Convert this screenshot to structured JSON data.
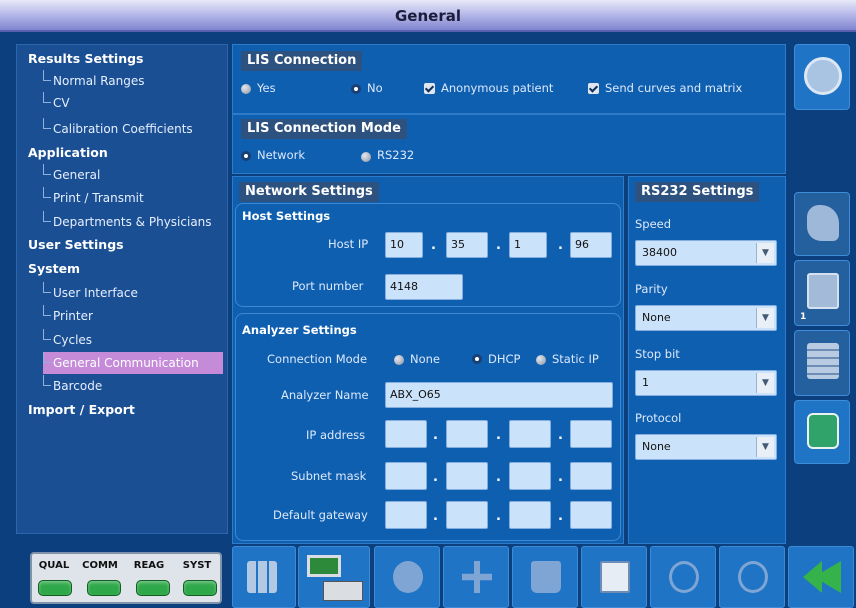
{
  "window": {
    "title": "General"
  },
  "nav": {
    "sections": [
      {
        "label": "Results Settings"
      },
      {
        "label": "Application"
      },
      {
        "label": "User Settings"
      },
      {
        "label": "System"
      },
      {
        "label": "Import / Export"
      }
    ],
    "children": [
      "Normal Ranges",
      "CV",
      "Calibration Coefficients",
      "General",
      "Print / Transmit",
      "Departments & Physicians",
      "User Interface",
      "Printer",
      "Cycles",
      "General Communication",
      "Barcode"
    ],
    "selected": "General Communication"
  },
  "lis_connection": {
    "title": "LIS Connection",
    "yes": "Yes",
    "no": "No",
    "selected": "No",
    "anonymous": "Anonymous patient",
    "send_curves": "Send curves and matrix"
  },
  "lis_mode": {
    "title": "LIS Connection Mode",
    "network": "Network",
    "rs232": "RS232",
    "selected": "Network"
  },
  "network": {
    "title": "Network Settings",
    "host_title": "Host Settings",
    "host_ip_label": "Host IP",
    "host_ip": [
      "10",
      "35",
      "1",
      "96"
    ],
    "port_label": "Port number",
    "port": "4148",
    "dot": ".",
    "analyzer_title": "Analyzer Settings",
    "conn_mode_label": "Connection Mode",
    "mode_none": "None",
    "mode_dhcp": "DHCP",
    "mode_static": "Static IP",
    "mode_selected": "DHCP",
    "analyzer_name_label": "Analyzer Name",
    "analyzer_name": "ABX_O65",
    "ip_label": "IP address",
    "subnet_label": "Subnet mask",
    "gateway_label": "Default gateway"
  },
  "rs232": {
    "title": "RS232 Settings",
    "speed_label": "Speed",
    "speed": "38400",
    "parity_label": "Parity",
    "parity": "None",
    "stop_label": "Stop bit",
    "stop": "1",
    "protocol_label": "Protocol",
    "protocol": "None"
  },
  "side_toolbar": {
    "page_number": "1"
  },
  "status": {
    "labels": [
      "QUAL",
      "COMM",
      "REAG",
      "SYST"
    ],
    "color": "#2fa84a"
  },
  "colors": {
    "background": "#0b3f7e",
    "panel": "#0f5fb0",
    "selected": "#c58bd9"
  }
}
